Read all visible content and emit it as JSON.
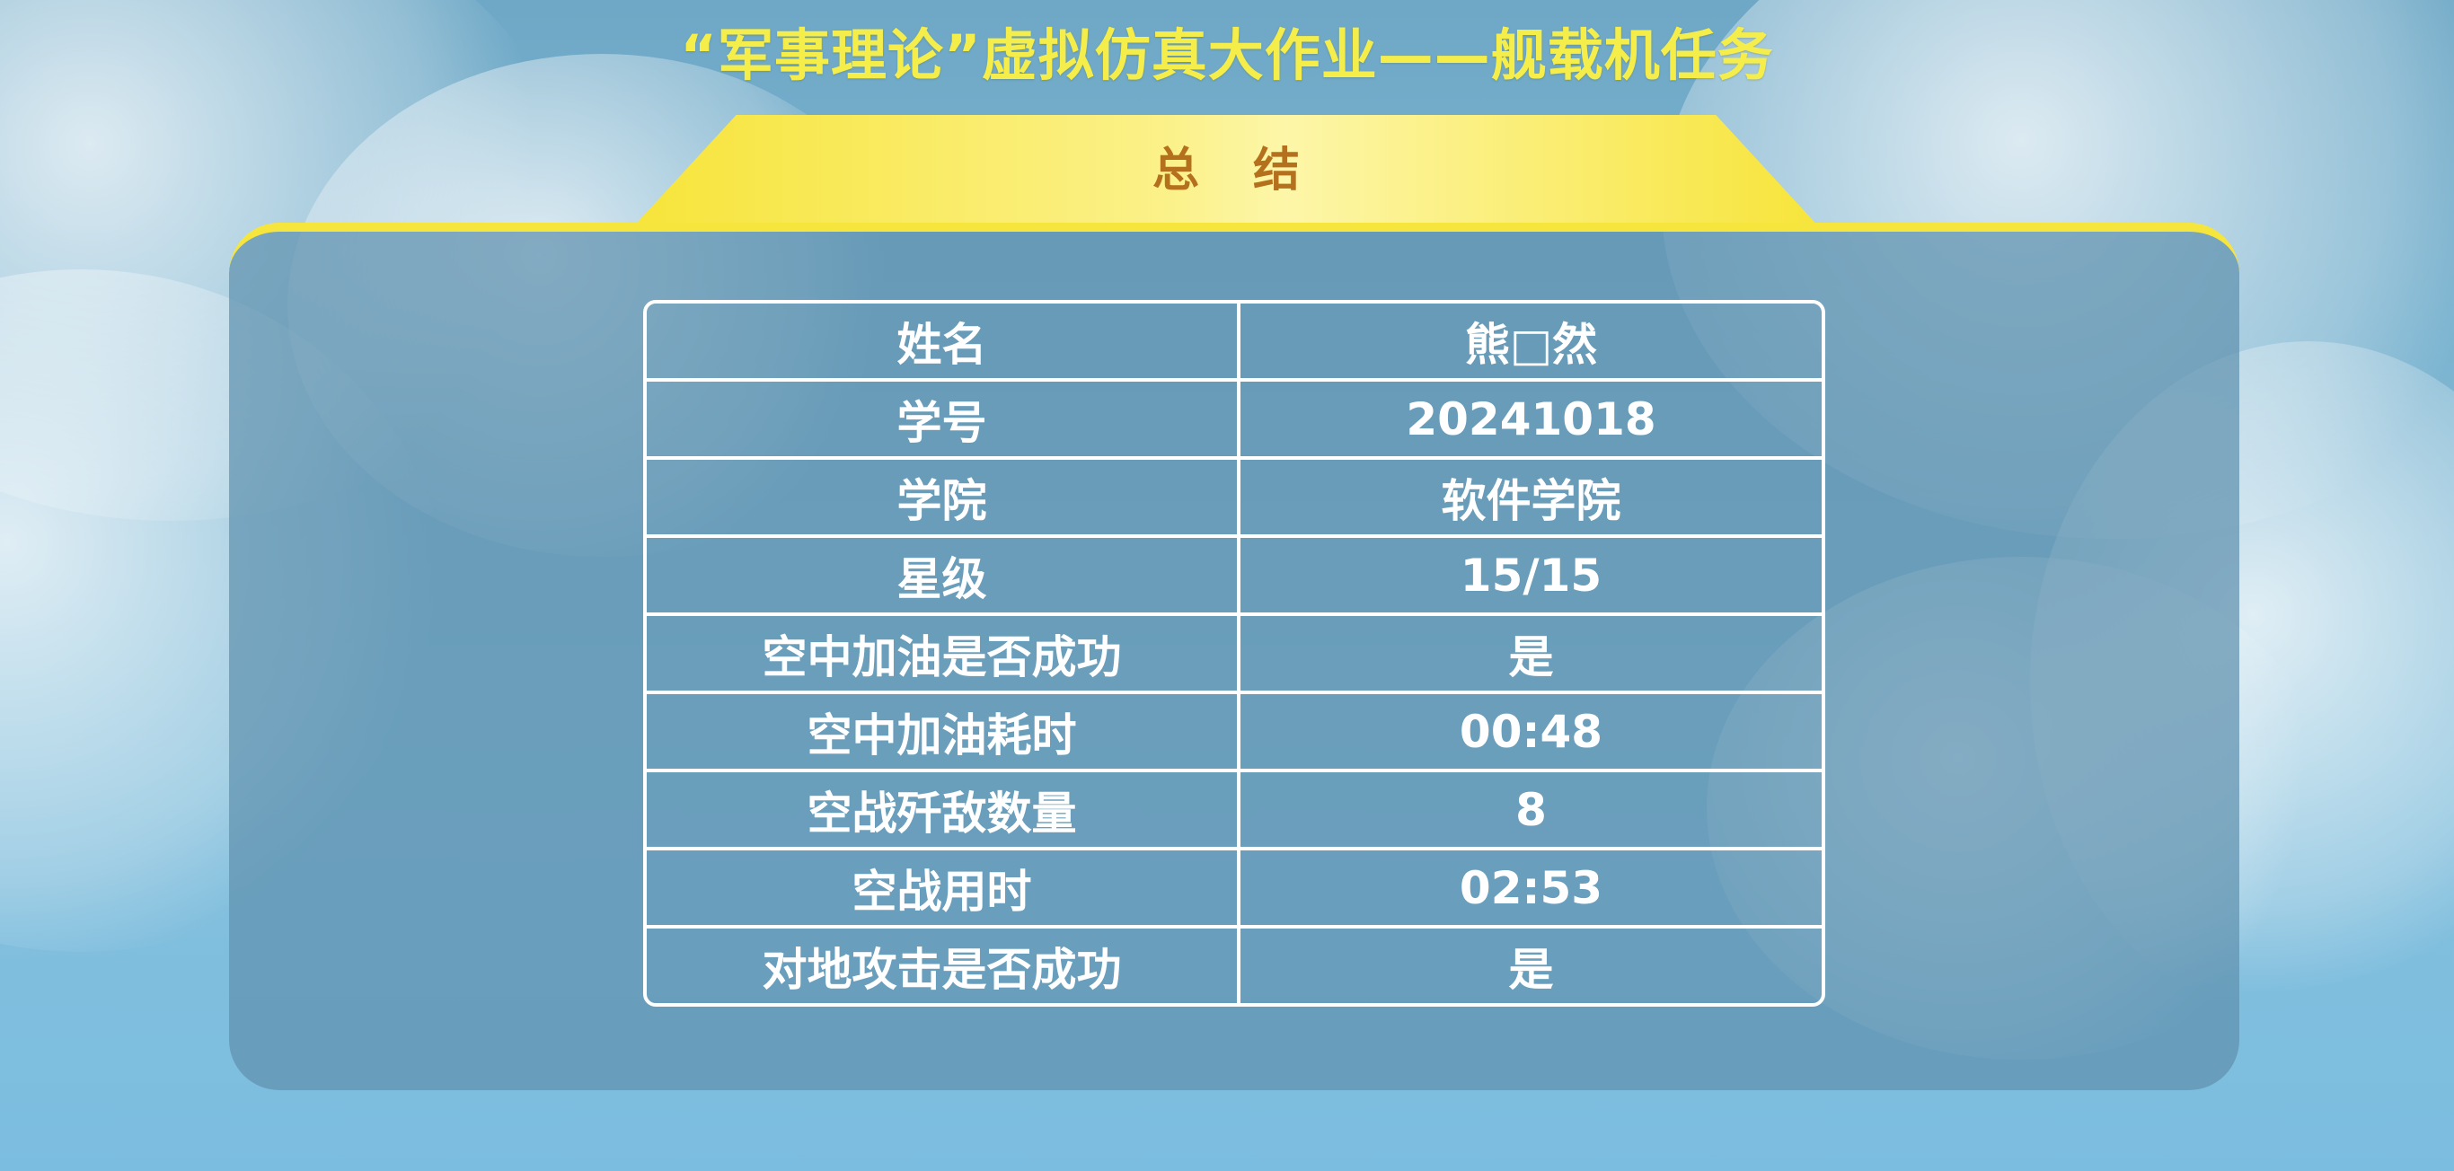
{
  "header": {
    "title": "“军事理论”虚拟仿真大作业——舰载机任务",
    "tab_label": "总结"
  },
  "summary_table": {
    "rows": [
      {
        "label": "姓名",
        "value": "熊□然"
      },
      {
        "label": "学号",
        "value": "20241018"
      },
      {
        "label": "学院",
        "value": "软件学院"
      },
      {
        "label": "星级",
        "value": "15/15"
      },
      {
        "label": "空中加油是否成功",
        "value": "是"
      },
      {
        "label": "空中加油耗时",
        "value": "00:48"
      },
      {
        "label": "空战歼敌数量",
        "value": "8"
      },
      {
        "label": "空战用时",
        "value": "02:53"
      },
      {
        "label": "对地攻击是否成功",
        "value": "是"
      }
    ]
  },
  "colors": {
    "title_yellow": "#f5ee4a",
    "tab_label_brown": "#b5701d",
    "panel_border_yellow": "#f6e53d",
    "sky_blue": "#7eb6d2"
  }
}
